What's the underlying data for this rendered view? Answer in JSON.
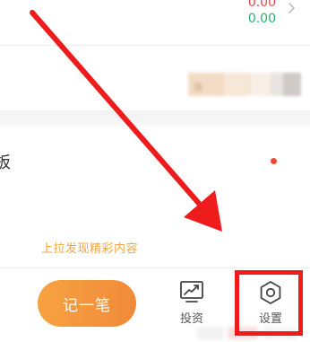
{
  "summary": {
    "amount_top": "0.00",
    "amount_bottom": "0.00",
    "chevron_icon": "chevron-right-icon"
  },
  "promo": {
    "ad_text": "简"
  },
  "list": {
    "row_title": "板"
  },
  "pull_hint": "上拉发现精彩内容",
  "bottom_nav": {
    "record_label": "记一笔",
    "invest_label": "投资",
    "invest_icon": "chart-up-icon",
    "settings_label": "设置",
    "settings_icon": "hexagon-gear-icon"
  },
  "colors": {
    "accent_orange": "#f08a3a",
    "amount_red": "#e5484d",
    "amount_green": "#24b36b",
    "annotation_red": "#ee1c1c"
  }
}
